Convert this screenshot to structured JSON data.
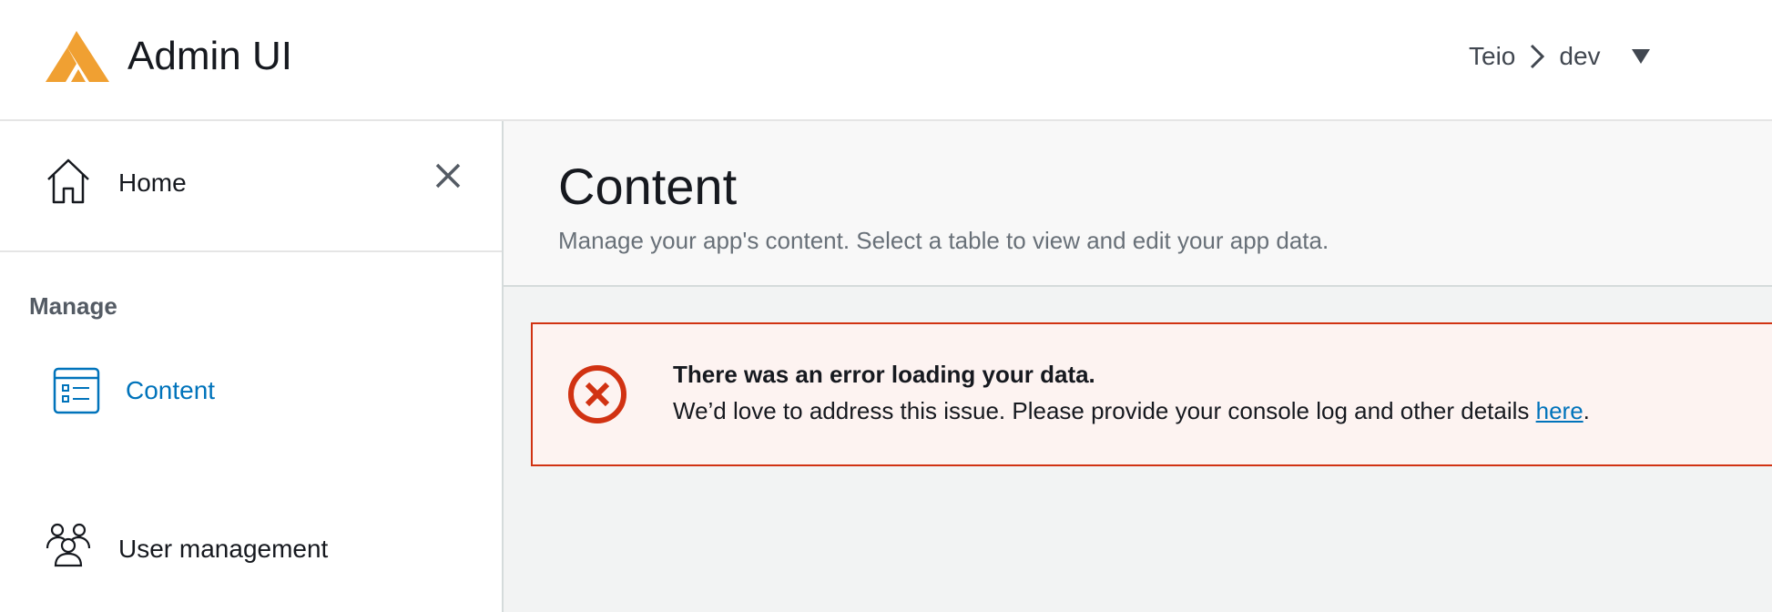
{
  "header": {
    "app_title": "Admin UI",
    "env": {
      "app": "Teio",
      "branch": "dev"
    }
  },
  "sidebar": {
    "home_label": "Home",
    "section_label": "Manage",
    "items": [
      {
        "label": "Content",
        "icon": "content-table-icon",
        "active": true
      },
      {
        "label": "User management",
        "icon": "users-icon",
        "active": false
      }
    ]
  },
  "main": {
    "title": "Content",
    "subtitle": "Manage your app's content. Select a table to view and edit your app data.",
    "alert": {
      "title": "There was an error loading your data.",
      "body_prefix": "We’d love to address this issue. Please provide your console log and other details ",
      "link_text": "here",
      "body_suffix": "."
    }
  },
  "colors": {
    "accent": "#0073bb",
    "logo": "#f0a032",
    "error": "#d13212",
    "error_bg": "#fdf3f1"
  }
}
